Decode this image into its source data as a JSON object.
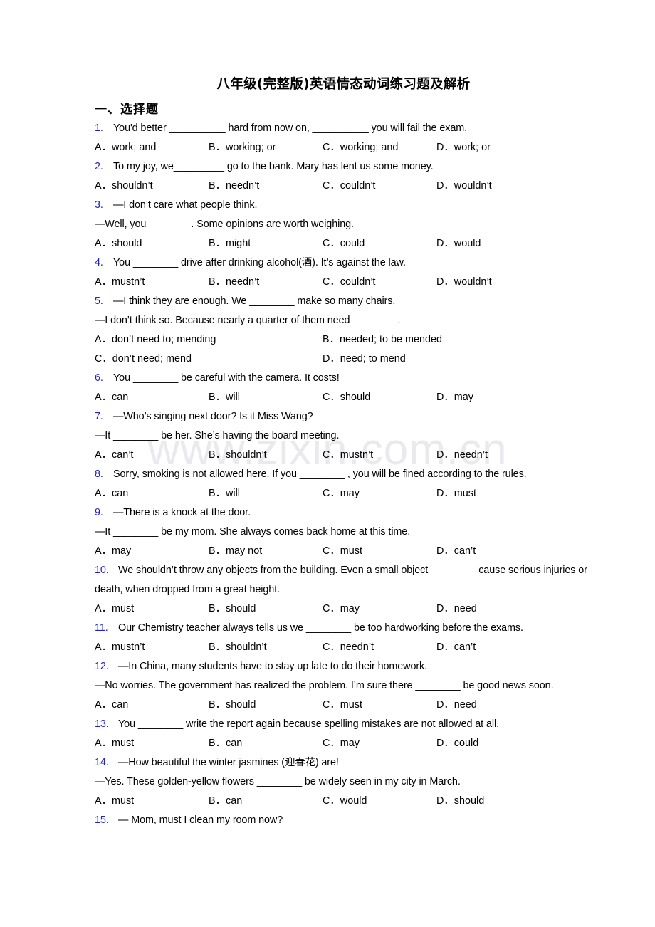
{
  "document": {
    "title": "八年级(完整版)英语情态动词练习题及解析",
    "section_heading": "一、选择题",
    "watermark": "www.zixin.com.cn",
    "number_color": "#2222cc",
    "text_color": "#000000"
  },
  "questions": [
    {
      "number": "1.",
      "lines": [
        "You'd better __________ hard from now on, __________ you will fail the exam."
      ],
      "option_layout": "cols4",
      "options": [
        {
          "letter": "A．",
          "label": "work; and"
        },
        {
          "letter": "B．",
          "label": "working; or"
        },
        {
          "letter": "C．",
          "label": "working; and"
        },
        {
          "letter": "D．",
          "label": "work; or"
        }
      ]
    },
    {
      "number": "2.",
      "lines": [
        "To my joy, we_________ go to the bank. Mary has lent us some money."
      ],
      "option_layout": "cols4",
      "options": [
        {
          "letter": "A．",
          "label": "shouldn’t"
        },
        {
          "letter": "B．",
          "label": "needn’t"
        },
        {
          "letter": "C．",
          "label": "couldn’t"
        },
        {
          "letter": "D．",
          "label": "wouldn’t"
        }
      ]
    },
    {
      "number": "3.",
      "lines": [
        "—I don’t care what people think.",
        "—Well, you _______ . Some opinions are worth weighing."
      ],
      "option_layout": "cols4",
      "options": [
        {
          "letter": "A．",
          "label": "should"
        },
        {
          "letter": "B．",
          "label": "might"
        },
        {
          "letter": "C．",
          "label": "could"
        },
        {
          "letter": "D．",
          "label": "would"
        }
      ]
    },
    {
      "number": "4.",
      "lines": [
        "You ________ drive after drinking alcohol(酒). It’s against the law."
      ],
      "option_layout": "cols4",
      "options": [
        {
          "letter": "A．",
          "label": "mustn’t"
        },
        {
          "letter": "B．",
          "label": "needn’t"
        },
        {
          "letter": "C．",
          "label": "couldn’t"
        },
        {
          "letter": "D．",
          "label": "wouldn’t"
        }
      ]
    },
    {
      "number": "5.",
      "lines": [
        "—I think they are enough. We ________ make so many chairs.",
        "—I don’t think so. Because nearly a quarter of them need ________."
      ],
      "option_layout": "cols2",
      "options": [
        {
          "letter": "A．",
          "label": "don’t need to; mending"
        },
        {
          "letter": "B．",
          "label": "needed; to be mended"
        },
        {
          "letter": "C．",
          "label": "don’t need; mend"
        },
        {
          "letter": "D．",
          "label": "need; to mend"
        }
      ]
    },
    {
      "number": "6.",
      "lines": [
        "You ________ be careful with the camera. It costs!"
      ],
      "option_layout": "cols4",
      "options": [
        {
          "letter": "A．",
          "label": "can"
        },
        {
          "letter": "B．",
          "label": "will"
        },
        {
          "letter": "C．",
          "label": "should"
        },
        {
          "letter": "D．",
          "label": "may"
        }
      ]
    },
    {
      "number": "7.",
      "lines": [
        "—Who’s singing next door? Is it Miss Wang?",
        "—It ________ be her. She’s having the board meeting."
      ],
      "option_layout": "cols4",
      "options": [
        {
          "letter": "A．",
          "label": "can’t"
        },
        {
          "letter": "B．",
          "label": "shouldn’t"
        },
        {
          "letter": "C．",
          "label": "mustn’t"
        },
        {
          "letter": "D．",
          "label": "needn’t"
        }
      ]
    },
    {
      "number": "8.",
      "lines": [
        "Sorry, smoking is not allowed here. If you ________ , you will be fined according to the rules."
      ],
      "option_layout": "cols4",
      "options": [
        {
          "letter": "A．",
          "label": "can"
        },
        {
          "letter": "B．",
          "label": "will"
        },
        {
          "letter": "C．",
          "label": "may"
        },
        {
          "letter": "D．",
          "label": "must"
        }
      ]
    },
    {
      "number": "9.",
      "lines": [
        "—There is a knock at the door.",
        "—It ________ be my mom. She always comes back home at this time."
      ],
      "option_layout": "cols4",
      "options": [
        {
          "letter": "A．",
          "label": "may"
        },
        {
          "letter": "B．",
          "label": "may not"
        },
        {
          "letter": "C．",
          "label": "must"
        },
        {
          "letter": "D．",
          "label": "can’t"
        }
      ]
    },
    {
      "number": "10.",
      "lines": [
        "We shouldn’t throw any objects from the building. Even a small object ________ cause serious injuries or death, when dropped from a great height."
      ],
      "option_layout": "cols4",
      "options": [
        {
          "letter": "A．",
          "label": "must"
        },
        {
          "letter": "B．",
          "label": "should"
        },
        {
          "letter": "C．",
          "label": "may"
        },
        {
          "letter": "D．",
          "label": "need"
        }
      ]
    },
    {
      "number": "11.",
      "lines": [
        "Our Chemistry teacher always tells us we ________ be too hardworking before the exams."
      ],
      "option_layout": "cols4",
      "options": [
        {
          "letter": "A．",
          "label": "mustn’t"
        },
        {
          "letter": "B．",
          "label": "shouldn’t"
        },
        {
          "letter": "C．",
          "label": "needn’t"
        },
        {
          "letter": "D．",
          "label": "can’t"
        }
      ]
    },
    {
      "number": "12.",
      "lines": [
        "—In China, many students have to stay up late to do their homework.",
        "—No worries. The government has realized the problem. I’m sure there ________ be good news soon."
      ],
      "option_layout": "cols4",
      "options": [
        {
          "letter": "A．",
          "label": "can"
        },
        {
          "letter": "B．",
          "label": "should"
        },
        {
          "letter": "C．",
          "label": "must"
        },
        {
          "letter": "D．",
          "label": "need"
        }
      ]
    },
    {
      "number": "13.",
      "lines": [
        "You ________ write the report again because spelling mistakes are not allowed at all."
      ],
      "option_layout": "cols4",
      "options": [
        {
          "letter": "A．",
          "label": "must"
        },
        {
          "letter": "B．",
          "label": "can"
        },
        {
          "letter": "C．",
          "label": "may"
        },
        {
          "letter": "D．",
          "label": "could"
        }
      ]
    },
    {
      "number": "14.",
      "lines": [
        "—How beautiful the winter jasmines (迎春花) are!",
        "—Yes. These golden-yellow flowers ________ be widely seen in my city in March."
      ],
      "option_layout": "cols4",
      "options": [
        {
          "letter": "A．",
          "label": "must"
        },
        {
          "letter": "B．",
          "label": "can"
        },
        {
          "letter": "C．",
          "label": "would"
        },
        {
          "letter": "D．",
          "label": "should"
        }
      ]
    },
    {
      "number": "15.",
      "lines": [
        "— Mom, must I clean my room now?"
      ],
      "option_layout": "none",
      "options": []
    }
  ]
}
